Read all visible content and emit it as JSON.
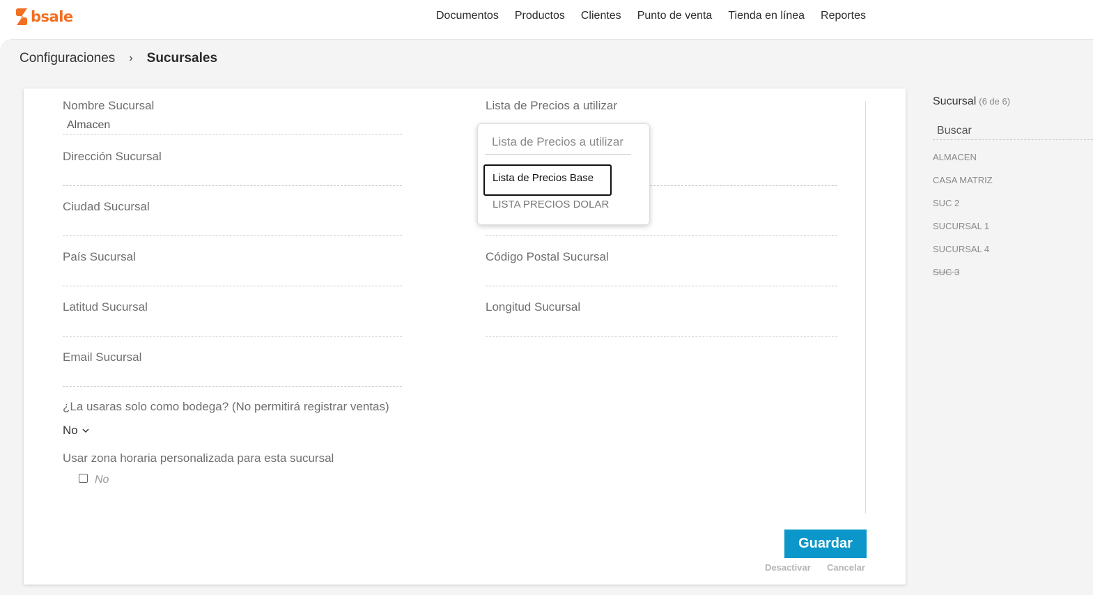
{
  "brand": {
    "name": "bsale",
    "color": "#f36f21"
  },
  "nav": [
    "Documentos",
    "Productos",
    "Clientes",
    "Punto de venta",
    "Tienda en línea",
    "Reportes"
  ],
  "breadcrumb": {
    "parent": "Configuraciones",
    "separator": "›",
    "current": "Sucursales"
  },
  "form": {
    "nombre": {
      "label": "Nombre Sucursal",
      "value": "Almacen"
    },
    "direccion": {
      "label": "Dirección Sucursal",
      "value": ""
    },
    "ciudad": {
      "label": "Ciudad Sucursal",
      "value": ""
    },
    "pais": {
      "label": "País Sucursal",
      "value": ""
    },
    "latitud": {
      "label": "Latitud Sucursal",
      "value": ""
    },
    "email": {
      "label": "Email Sucursal",
      "value": ""
    },
    "lista_precios": {
      "label": "Lista de Precios a utilizar"
    },
    "codigo_postal": {
      "label": "Código Postal Sucursal",
      "value": ""
    },
    "longitud": {
      "label": "Longitud Sucursal",
      "value": ""
    },
    "bodega": {
      "label": "¿La usaras solo como bodega? (No permitirá registrar ventas)",
      "value": "No"
    },
    "zona_horaria": {
      "label": "Usar zona horaria personalizada para esta sucursal",
      "checkbox_label": "No",
      "checked": false
    }
  },
  "dropdown": {
    "search_placeholder": "Lista de Precios a utilizar",
    "options": [
      "Lista de Precios Base",
      "LISTA PRECIOS DOLAR"
    ],
    "selected": "Lista de Precios Base"
  },
  "actions": {
    "save": "Guardar",
    "deactivate": "Desactivar",
    "cancel": "Cancelar",
    "save_color": "#0b97c9"
  },
  "sidebar": {
    "title": "Sucursal",
    "count": "(6 de 6)",
    "search_placeholder": "Buscar",
    "items": [
      {
        "label": "ALMACEN",
        "inactive": false
      },
      {
        "label": "CASA MATRIZ",
        "inactive": false
      },
      {
        "label": "SUC 2",
        "inactive": false
      },
      {
        "label": "SUCURSAL 1",
        "inactive": false
      },
      {
        "label": "SUCURSAL 4",
        "inactive": false
      },
      {
        "label": "SUC 3",
        "inactive": true
      }
    ]
  }
}
